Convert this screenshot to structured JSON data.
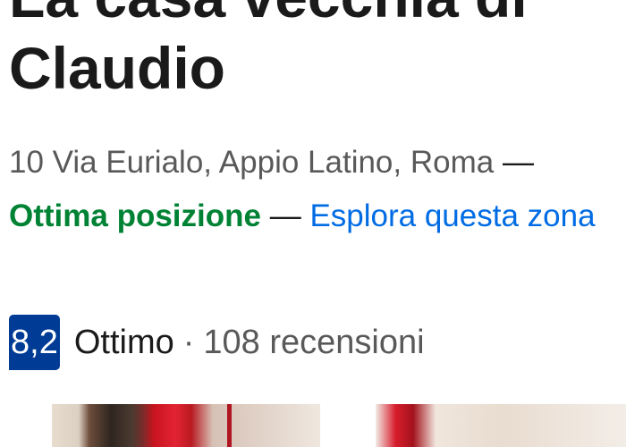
{
  "property": {
    "name": "La casa vecchia di Claudio",
    "address": "10 Via Eurialo, Appio Latino, Roma",
    "separator": "—",
    "location_badge": "Ottima posizione",
    "explore_link": "Esplora questa zona"
  },
  "rating": {
    "score": "8,2",
    "label": "Ottimo",
    "dot": "·",
    "reviews": "108 recensioni"
  },
  "colors": {
    "score_badge_bg": "#003b95",
    "location_green": "#008234",
    "link_blue": "#006ce4"
  }
}
